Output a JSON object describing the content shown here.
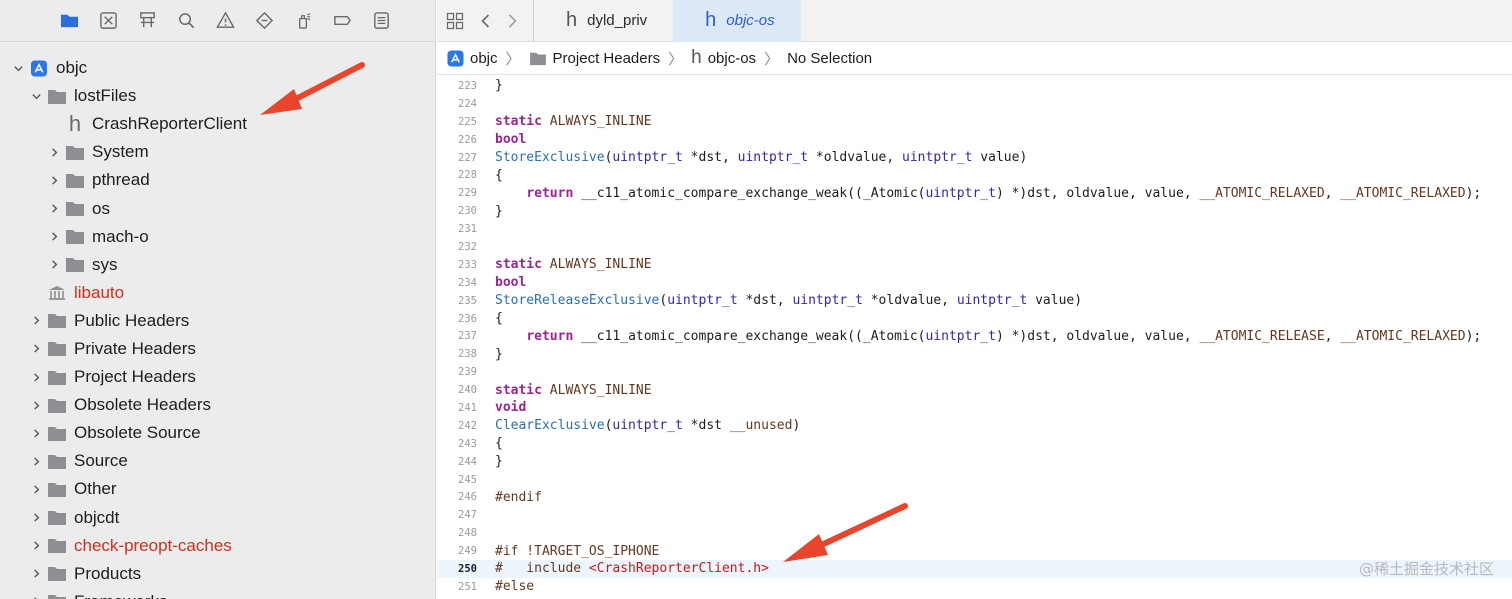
{
  "navigator_toolbar": {
    "icons": [
      "folder-icon",
      "x-square-icon",
      "hierarchy-icon",
      "search-icon",
      "warning-icon",
      "diamond-icon",
      "spray-icon",
      "tag-icon",
      "list-icon"
    ]
  },
  "tree": [
    {
      "label": "objc",
      "level": 0,
      "expanded": true,
      "icon": "app-icon",
      "red": false
    },
    {
      "label": "lostFiles",
      "level": 1,
      "expanded": true,
      "icon": "folder-icon",
      "red": false
    },
    {
      "label": "CrashReporterClient",
      "level": 2,
      "expanded": null,
      "icon": "header-file-icon",
      "red": false
    },
    {
      "label": "System",
      "level": 2,
      "expanded": false,
      "icon": "folder-icon",
      "red": false
    },
    {
      "label": "pthread",
      "level": 2,
      "expanded": false,
      "icon": "folder-icon",
      "red": false
    },
    {
      "label": "os",
      "level": 2,
      "expanded": false,
      "icon": "folder-icon",
      "red": false
    },
    {
      "label": "mach-o",
      "level": 2,
      "expanded": false,
      "icon": "folder-icon",
      "red": false
    },
    {
      "label": "sys",
      "level": 2,
      "expanded": false,
      "icon": "folder-icon",
      "red": false
    },
    {
      "label": "libauto",
      "level": 1,
      "expanded": null,
      "icon": "library-icon",
      "red": true
    },
    {
      "label": "Public Headers",
      "level": 1,
      "expanded": false,
      "icon": "folder-icon",
      "red": false
    },
    {
      "label": "Private Headers",
      "level": 1,
      "expanded": false,
      "icon": "folder-icon",
      "red": false
    },
    {
      "label": "Project Headers",
      "level": 1,
      "expanded": false,
      "icon": "folder-icon",
      "red": false
    },
    {
      "label": "Obsolete Headers",
      "level": 1,
      "expanded": false,
      "icon": "folder-icon",
      "red": false
    },
    {
      "label": "Obsolete Source",
      "level": 1,
      "expanded": false,
      "icon": "folder-icon",
      "red": false
    },
    {
      "label": "Source",
      "level": 1,
      "expanded": false,
      "icon": "folder-icon",
      "red": false
    },
    {
      "label": "Other",
      "level": 1,
      "expanded": false,
      "icon": "folder-icon",
      "red": false
    },
    {
      "label": "objcdt",
      "level": 1,
      "expanded": false,
      "icon": "folder-icon",
      "red": false
    },
    {
      "label": "check-preopt-caches",
      "level": 1,
      "expanded": false,
      "icon": "folder-icon",
      "red": true
    },
    {
      "label": "Products",
      "level": 1,
      "expanded": false,
      "icon": "folder-icon",
      "red": false
    },
    {
      "label": "Frameworks",
      "level": 1,
      "expanded": false,
      "icon": "folder-icon",
      "red": false
    }
  ],
  "tabs": [
    {
      "glyph": "h",
      "label": "dyld_priv",
      "active": false
    },
    {
      "glyph": "h",
      "label": "objc-os",
      "active": true
    }
  ],
  "jumpbar": {
    "items": [
      "objc",
      "Project Headers",
      "objc-os",
      "No Selection"
    ],
    "separator": "〉",
    "h_glyph": "h"
  },
  "code": {
    "current_line": 250,
    "lines": [
      {
        "n": "223",
        "t": [
          [
            "pl",
            "}"
          ]
        ]
      },
      {
        "n": "224",
        "t": []
      },
      {
        "n": "225",
        "t": [
          [
            "k",
            "static"
          ],
          [
            "pl",
            " "
          ],
          [
            "mac",
            "ALWAYS_INLINE"
          ]
        ]
      },
      {
        "n": "226",
        "t": [
          [
            "k",
            "bool"
          ]
        ]
      },
      {
        "n": "227",
        "t": [
          [
            "fn",
            "StoreExclusive"
          ],
          [
            "pl",
            "("
          ],
          [
            "ty",
            "uintptr_t"
          ],
          [
            "pl",
            " *dst, "
          ],
          [
            "ty",
            "uintptr_t"
          ],
          [
            "pl",
            " *oldvalue, "
          ],
          [
            "ty",
            "uintptr_t"
          ],
          [
            "pl",
            " value)"
          ]
        ]
      },
      {
        "n": "228",
        "t": [
          [
            "pl",
            "{"
          ]
        ]
      },
      {
        "n": "229",
        "t": [
          [
            "pl",
            "    "
          ],
          [
            "k",
            "return"
          ],
          [
            "pl",
            " __c11_atomic_compare_exchange_weak((_Atomic("
          ],
          [
            "ty",
            "uintptr_t"
          ],
          [
            "pl",
            ") *)dst, oldvalue, value, "
          ],
          [
            "mac",
            "__ATOMIC_RELAXED"
          ],
          [
            "pl",
            ", "
          ],
          [
            "mac",
            "__ATOMIC_RELAXED"
          ],
          [
            "pl",
            ");"
          ]
        ]
      },
      {
        "n": "230",
        "t": [
          [
            "pl",
            "}"
          ]
        ]
      },
      {
        "n": "231",
        "t": []
      },
      {
        "n": "232",
        "t": []
      },
      {
        "n": "233",
        "t": [
          [
            "k",
            "static"
          ],
          [
            "pl",
            " "
          ],
          [
            "mac",
            "ALWAYS_INLINE"
          ]
        ]
      },
      {
        "n": "234",
        "t": [
          [
            "k",
            "bool"
          ]
        ]
      },
      {
        "n": "235",
        "t": [
          [
            "fn",
            "StoreReleaseExclusive"
          ],
          [
            "pl",
            "("
          ],
          [
            "ty",
            "uintptr_t"
          ],
          [
            "pl",
            " *dst, "
          ],
          [
            "ty",
            "uintptr_t"
          ],
          [
            "pl",
            " *oldvalue, "
          ],
          [
            "ty",
            "uintptr_t"
          ],
          [
            "pl",
            " value)"
          ]
        ]
      },
      {
        "n": "236",
        "t": [
          [
            "pl",
            "{"
          ]
        ]
      },
      {
        "n": "237",
        "t": [
          [
            "pl",
            "    "
          ],
          [
            "k",
            "return"
          ],
          [
            "pl",
            " __c11_atomic_compare_exchange_weak((_Atomic("
          ],
          [
            "ty",
            "uintptr_t"
          ],
          [
            "pl",
            ") *)dst, oldvalue, value, "
          ],
          [
            "mac",
            "__ATOMIC_RELEASE"
          ],
          [
            "pl",
            ", "
          ],
          [
            "mac",
            "__ATOMIC_RELAXED"
          ],
          [
            "pl",
            ");"
          ]
        ]
      },
      {
        "n": "238",
        "t": [
          [
            "pl",
            "}"
          ]
        ]
      },
      {
        "n": "239",
        "t": []
      },
      {
        "n": "240",
        "t": [
          [
            "k",
            "static"
          ],
          [
            "pl",
            " "
          ],
          [
            "mac",
            "ALWAYS_INLINE"
          ]
        ]
      },
      {
        "n": "241",
        "t": [
          [
            "k",
            "void"
          ]
        ]
      },
      {
        "n": "242",
        "t": [
          [
            "fn",
            "ClearExclusive"
          ],
          [
            "pl",
            "("
          ],
          [
            "ty",
            "uintptr_t"
          ],
          [
            "pl",
            " *dst "
          ],
          [
            "mac",
            "__unused"
          ],
          [
            "pl",
            ")"
          ]
        ]
      },
      {
        "n": "243",
        "t": [
          [
            "pl",
            "{"
          ]
        ]
      },
      {
        "n": "244",
        "t": [
          [
            "pl",
            "}"
          ]
        ]
      },
      {
        "n": "245",
        "t": []
      },
      {
        "n": "246",
        "t": [
          [
            "pp",
            "#endif"
          ]
        ]
      },
      {
        "n": "247",
        "t": []
      },
      {
        "n": "248",
        "t": []
      },
      {
        "n": "249",
        "t": [
          [
            "pp",
            "#if !TARGET_OS_IPHONE"
          ]
        ]
      },
      {
        "n": "250",
        "t": [
          [
            "pp",
            "#   include "
          ],
          [
            "str",
            "<CrashReporterClient.h>"
          ]
        ]
      },
      {
        "n": "251",
        "t": [
          [
            "pp",
            "#else"
          ]
        ]
      }
    ]
  },
  "watermark": "@稀土掘金技术社区",
  "colors": {
    "annotation_arrow": "#e8452c",
    "selection_blue": "#2b5fc9",
    "missing_file_red": "#d12f1b"
  }
}
